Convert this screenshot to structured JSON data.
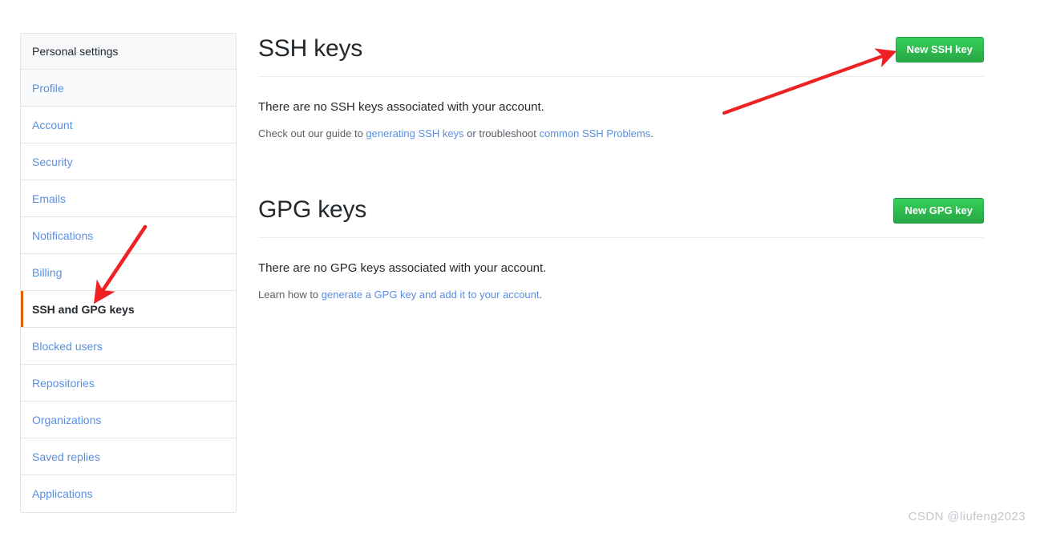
{
  "sidebar": {
    "header": "Personal settings",
    "items": [
      {
        "label": "Profile",
        "active": false
      },
      {
        "label": "Account",
        "active": false
      },
      {
        "label": "Security",
        "active": false
      },
      {
        "label": "Emails",
        "active": false
      },
      {
        "label": "Notifications",
        "active": false
      },
      {
        "label": "Billing",
        "active": false
      },
      {
        "label": "SSH and GPG keys",
        "active": true
      },
      {
        "label": "Blocked users",
        "active": false
      },
      {
        "label": "Repositories",
        "active": false
      },
      {
        "label": "Organizations",
        "active": false
      },
      {
        "label": "Saved replies",
        "active": false
      },
      {
        "label": "Applications",
        "active": false
      }
    ]
  },
  "ssh_section": {
    "title": "SSH keys",
    "button": "New SSH key",
    "empty_message": "There are no SSH keys associated with your account.",
    "help_prefix": "Check out our guide to ",
    "help_link_1": "generating SSH keys",
    "help_middle": " or troubleshoot ",
    "help_link_2": "common SSH Problems",
    "help_suffix": "."
  },
  "gpg_section": {
    "title": "GPG keys",
    "button": "New GPG key",
    "empty_message": "There are no GPG keys associated with your account.",
    "help_prefix": "Learn how to ",
    "help_link_1": "generate a GPG key and add it to your account",
    "help_suffix": "."
  },
  "annotations": {
    "arrow_color": "#ee2222",
    "arrow_1_target": "New SSH key",
    "arrow_2_target": "SSH and GPG keys"
  },
  "watermark": "CSDN @liufeng2023",
  "colors": {
    "accent_green": "#2cbe4e",
    "link_blue": "#5a8fe0",
    "active_border": "#e36209",
    "border": "#e1e4e8",
    "text": "#24292e"
  }
}
